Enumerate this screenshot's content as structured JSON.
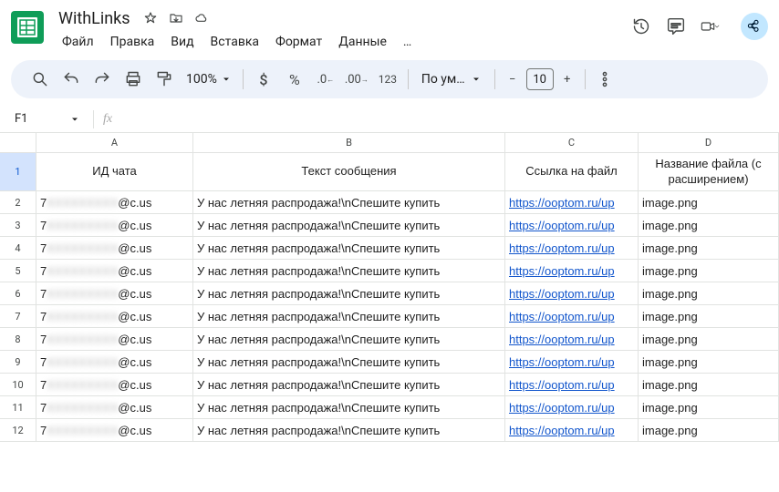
{
  "doc": {
    "title": "WithLinks"
  },
  "menus": [
    "Файл",
    "Правка",
    "Вид",
    "Вставка",
    "Формат",
    "Данные",
    "…"
  ],
  "toolbar": {
    "zoom": "100%",
    "font": "По ум…",
    "fontsize": "10"
  },
  "namebox": "F1",
  "columns": [
    "A",
    "B",
    "C",
    "D"
  ],
  "headers": {
    "a": "ИД чата",
    "b": "Текст сообщения",
    "c": "Ссылка на файл",
    "d": "Название файла (с расширением)"
  },
  "rows": [
    {
      "n": "2",
      "a_prefix": "7",
      "a_mid": "XXXXXXXXX",
      "a_suffix": "@c.us",
      "b": "У нас летняя распродажа!\\nСпешите купить",
      "c": "https://ooptom.ru/up",
      "d": "image.png"
    },
    {
      "n": "3",
      "a_prefix": "7",
      "a_mid": "XXXXXXXXX",
      "a_suffix": "@c.us",
      "b": "У нас летняя распродажа!\\nСпешите купить",
      "c": "https://ooptom.ru/up",
      "d": "image.png"
    },
    {
      "n": "4",
      "a_prefix": "7",
      "a_mid": "XXXXXXXXX",
      "a_suffix": "@c.us",
      "b": "У нас летняя распродажа!\\nСпешите купить",
      "c": "https://ooptom.ru/up",
      "d": "image.png"
    },
    {
      "n": "5",
      "a_prefix": "7",
      "a_mid": "XXXXXXXXX",
      "a_suffix": "@c.us",
      "b": "У нас летняя распродажа!\\nСпешите купить",
      "c": "https://ooptom.ru/up",
      "d": "image.png"
    },
    {
      "n": "6",
      "a_prefix": "7",
      "a_mid": "XXXXXXXXX",
      "a_suffix": "@c.us",
      "b": "У нас летняя распродажа!\\nСпешите купить",
      "c": "https://ooptom.ru/up",
      "d": "image.png"
    },
    {
      "n": "7",
      "a_prefix": "7",
      "a_mid": "XXXXXXXXX",
      "a_suffix": "@c.us",
      "b": "У нас летняя распродажа!\\nСпешите купить",
      "c": "https://ooptom.ru/up",
      "d": "image.png"
    },
    {
      "n": "8",
      "a_prefix": "7",
      "a_mid": "XXXXXXXXX",
      "a_suffix": "@c.us",
      "b": "У нас летняя распродажа!\\nСпешите купить",
      "c": "https://ooptom.ru/up",
      "d": "image.png"
    },
    {
      "n": "9",
      "a_prefix": "7",
      "a_mid": "XXXXXXXXX",
      "a_suffix": "@c.us",
      "b": "У нас летняя распродажа!\\nСпешите купить",
      "c": "https://ooptom.ru/up",
      "d": "image.png"
    },
    {
      "n": "10",
      "a_prefix": "7",
      "a_mid": "XXXXXXXXX",
      "a_suffix": "@c.us",
      "b": "У нас летняя распродажа!\\nСпешите купить",
      "c": "https://ooptom.ru/up",
      "d": "image.png"
    },
    {
      "n": "11",
      "a_prefix": "7",
      "a_mid": "XXXXXXXXX",
      "a_suffix": "@c.us",
      "b": "У нас летняя распродажа!\\nСпешите купить",
      "c": "https://ooptom.ru/up",
      "d": "image.png"
    },
    {
      "n": "12",
      "a_prefix": "7",
      "a_mid": "XXXXXXXXX",
      "a_suffix": "@c.us",
      "b": "У нас летняя распродажа!\\nСпешите купить",
      "c": "https://ooptom.ru/up",
      "d": "image.png"
    }
  ]
}
